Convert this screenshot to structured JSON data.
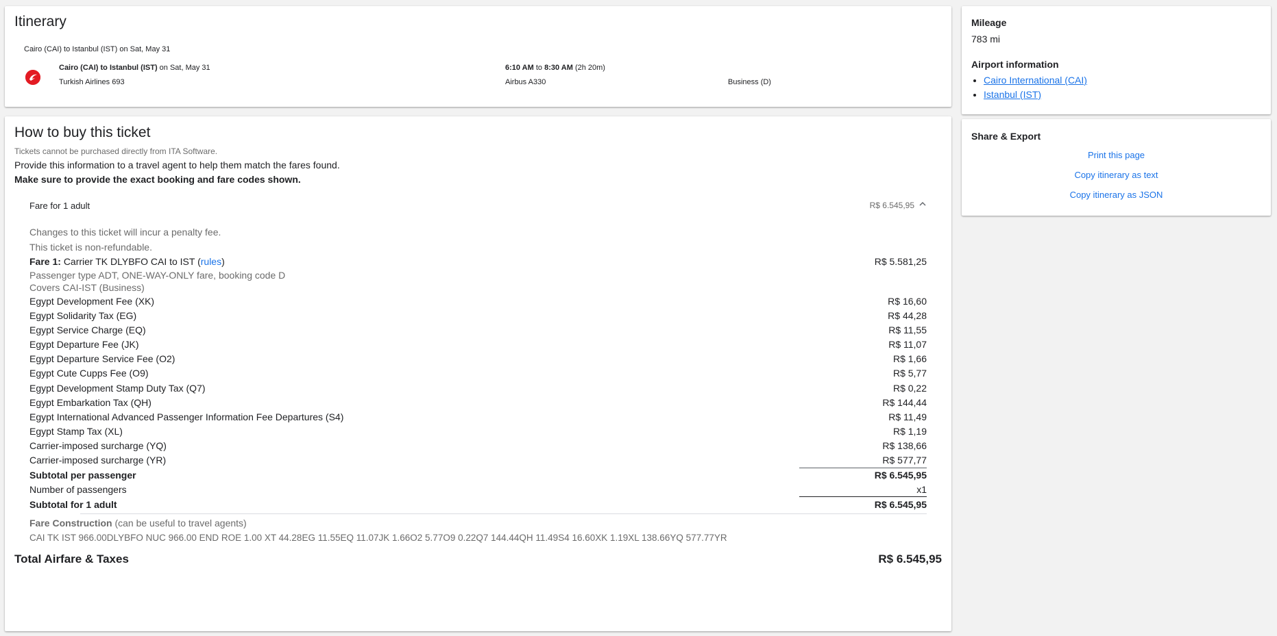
{
  "itinerary": {
    "title": "Itinerary",
    "trip_summary": "Cairo (CAI) to Istanbul (IST) on Sat, May 31",
    "flight": {
      "route": "Cairo (CAI) to Istanbul (IST)",
      "date_suffix": "on Sat, May 31",
      "carrier_flight": "Turkish Airlines 693",
      "depart_time": "6:10 AM",
      "to_word": "to",
      "arrive_time": "8:30 AM",
      "duration": "(2h 20m)",
      "aircraft": "Airbus A330",
      "cabin": "Business (D)",
      "airline_logo_icon": "turkish-airlines-logo-icon",
      "logo_color": "#e31b23"
    }
  },
  "buy": {
    "title": "How to buy this ticket",
    "note": "Tickets cannot be purchased directly from ITA Software.",
    "instruction": "Provide this information to a travel agent to help them match the fares found.",
    "instruction_bold": "Make sure to provide the exact booking and fare codes shown.",
    "fare_header": {
      "label": "Fare for 1 adult",
      "amount": "R$ 6.545,95",
      "toggle_icon": "chevron-up-icon"
    },
    "penalty_note": "Changes to this ticket will incur a penalty fee.",
    "refund_note": "This ticket is non-refundable.",
    "fare1": {
      "prefix": "Fare 1:",
      "text": "Carrier TK DLYBFO CAI to IST (",
      "rules_link": "rules",
      "close_paren": ")",
      "amount": "R$ 5.581,25",
      "passenger_type": "Passenger type ADT, ONE-WAY-ONLY fare, booking code D",
      "covers": "Covers CAI-IST (Business)"
    },
    "taxes": [
      {
        "label": "Egypt Development Fee (XK)",
        "amount": "R$ 16,60"
      },
      {
        "label": "Egypt Solidarity Tax (EG)",
        "amount": "R$ 44,28"
      },
      {
        "label": "Egypt Service Charge (EQ)",
        "amount": "R$ 11,55"
      },
      {
        "label": "Egypt Departure Fee (JK)",
        "amount": "R$ 11,07"
      },
      {
        "label": "Egypt Departure Service Fee (O2)",
        "amount": "R$ 1,66"
      },
      {
        "label": "Egypt Cute Cupps Fee (O9)",
        "amount": "R$ 5,77"
      },
      {
        "label": "Egypt Development Stamp Duty Tax (Q7)",
        "amount": "R$ 0,22"
      },
      {
        "label": "Egypt Embarkation Tax (QH)",
        "amount": "R$ 144,44"
      },
      {
        "label": "Egypt International Advanced Passenger Information Fee Departures (S4)",
        "amount": "R$ 11,49"
      },
      {
        "label": "Egypt Stamp Tax (XL)",
        "amount": "R$ 1,19"
      },
      {
        "label": "Carrier-imposed surcharge (YQ)",
        "amount": "R$ 138,66"
      },
      {
        "label": "Carrier-imposed surcharge (YR)",
        "amount": "R$ 577,77"
      }
    ],
    "subtotal_per_passenger": {
      "label": "Subtotal per passenger",
      "amount": "R$ 6.545,95"
    },
    "num_passengers": {
      "label": "Number of passengers",
      "amount": "x1"
    },
    "subtotal_adult": {
      "label": "Subtotal for 1 adult",
      "amount": "R$ 6.545,95"
    },
    "fare_construction": {
      "label": "Fare Construction",
      "hint": "(can be useful to travel agents)",
      "text": "CAI TK IST 966.00DLYBFO NUC 966.00 END ROE 1.00 XT 44.28EG 11.55EQ 11.07JK 1.66O2 5.77O9 0.22Q7 144.44QH 11.49S4 16.60XK 1.19XL 138.66YQ 577.77YR"
    },
    "total": {
      "label": "Total Airfare & Taxes",
      "amount": "R$ 6.545,95"
    }
  },
  "sidebar": {
    "mileage_title": "Mileage",
    "mileage_value": "783 mi",
    "airport_title": "Airport information",
    "airports": [
      "Cairo International (CAI)",
      "Istanbul (IST)"
    ],
    "share_title": "Share & Export",
    "share_links": [
      "Print this page",
      "Copy itinerary as text",
      "Copy itinerary as JSON"
    ]
  }
}
